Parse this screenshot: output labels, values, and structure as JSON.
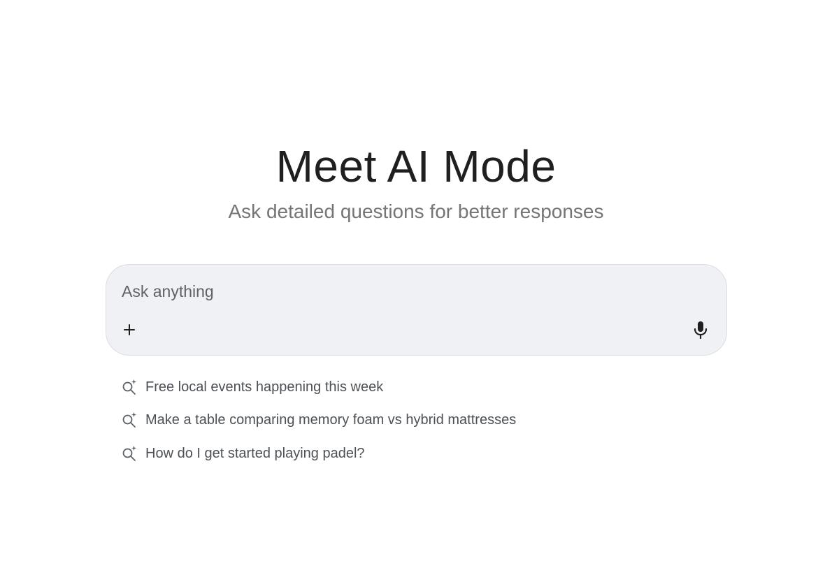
{
  "hero": {
    "title": "Meet AI Mode",
    "subtitle": "Ask detailed questions for better responses"
  },
  "search": {
    "placeholder": "Ask anything",
    "value": "",
    "add_icon": "plus-icon",
    "voice_icon": "microphone-icon"
  },
  "suggestions": [
    {
      "label": "Free local events happening this week",
      "icon": "search-sparkle-icon"
    },
    {
      "label": "Make a table comparing memory foam vs hybrid mattresses",
      "icon": "search-sparkle-icon"
    },
    {
      "label": "How do I get started playing padel?",
      "icon": "search-sparkle-icon"
    }
  ],
  "colors": {
    "background": "#ffffff",
    "search_box": "#f0f1f5",
    "search_border": "#dcdde2",
    "title": "#1f1f1f",
    "subtitle": "#757575",
    "suggestion_text": "#4d5156",
    "icon": "#5f6368"
  }
}
